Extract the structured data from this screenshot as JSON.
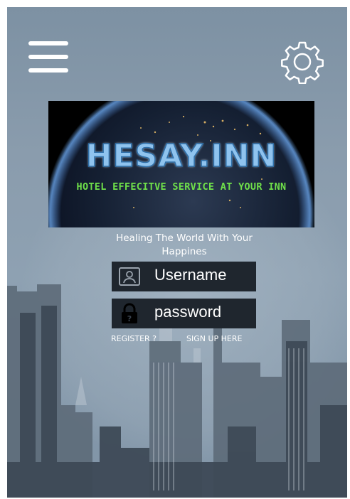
{
  "header": {
    "menu_icon": "hamburger-menu-icon",
    "settings_icon": "gear-icon"
  },
  "banner": {
    "title": "HESAY.INN",
    "subtitle": "HOTEL EFFECITVE SERVICE AT YOUR INN"
  },
  "tagline": "Healing The World With Your Happines",
  "login": {
    "username_placeholder": "Username",
    "username_icon": "user-id-icon",
    "password_placeholder": "password",
    "password_icon": "padlock-icon"
  },
  "links": {
    "register": "REGISTER ?",
    "sign_up": "SIGN UP HERE"
  },
  "colors": {
    "background": "#8a9cad",
    "field_background": "#1f262e",
    "banner_title": "#8fc3ee",
    "banner_subtitle": "#6fe04a",
    "text": "#ffffff"
  }
}
